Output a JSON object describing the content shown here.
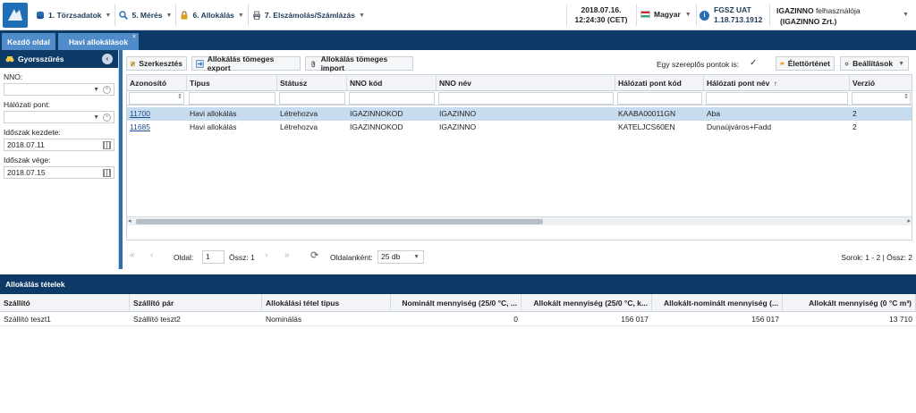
{
  "header": {
    "menu": [
      {
        "label": "1. Törzsadatok",
        "icon": "database-icon"
      },
      {
        "label": "5. Mérés",
        "icon": "magnifier-icon"
      },
      {
        "label": "6. Allokálás",
        "icon": "lock-icon"
      },
      {
        "label": "7. Elszámolás/Számlázás",
        "icon": "printer-icon"
      }
    ],
    "date": "2018.07.16.",
    "time": "12:24:30 (CET)",
    "language": "Magyar",
    "env_name": "FGSZ UAT",
    "version": "1.18.713.1912",
    "user_name": "IGAZINNO",
    "user_suffix": "felhasználója",
    "company": "(IGAZINNO Zrt.)"
  },
  "tabs": [
    {
      "label": "Kezdő oldal"
    },
    {
      "label": "Havi allokálások",
      "close": "×"
    }
  ],
  "quickfilter": {
    "title": "Gyorsszűrés",
    "fields": [
      {
        "label": "NNO:",
        "value": ""
      },
      {
        "label": "Hálózati pont:",
        "value": ""
      },
      {
        "label": "Időszak kezdete:",
        "value": "2018.07.11"
      },
      {
        "label": "Időszak vége:",
        "value": "2018.07.15"
      }
    ]
  },
  "toolbar": {
    "edit": "Szerkesztés",
    "export": "Allokálás tömeges export",
    "import": "Allokálás tömeges import",
    "single_player_label": "Egy szereplős pontok is:",
    "history": "Élettörténet",
    "settings": "Beállítások"
  },
  "grid": {
    "columns": [
      "Azonosító",
      "Típus",
      "Státusz",
      "NNO kód",
      "NNO név",
      "Hálózati pont kód",
      "Hálózati pont név",
      "Verzió"
    ],
    "rows": [
      {
        "id": "11700",
        "type": "Havi allokálás",
        "status": "Létrehozva",
        "nno_code": "IGAZINNOKOD",
        "nno_name": "IGAZINNO",
        "point_code": "KAABA00011GN",
        "point_name": "Aba",
        "version": "2"
      },
      {
        "id": "11685",
        "type": "Havi allokálás",
        "status": "Létrehozva",
        "nno_code": "IGAZINNOKOD",
        "nno_name": "IGAZINNO",
        "point_code": "KATELJCS60EN",
        "point_name": "Dunaújváros+Fadd",
        "version": "2"
      }
    ]
  },
  "pager": {
    "page_label": "Oldal:",
    "page": "1",
    "total": "Össz: 1",
    "per_page_label": "Oldalanként:",
    "per_page": "25 db",
    "summary": "Sorok: 1 - 2 | Össz: 2"
  },
  "items": {
    "title": "Allokálás tételek",
    "columns": [
      "Szállító",
      "Szállító pár",
      "Allokálási tétel típus",
      "Nominált mennyiség (25/0 °C, ...",
      "Allokált mennyiség (25/0 °C, k...",
      "Allokált-nominált mennyiség (...",
      "Allokált mennyiség (0 °C m³)"
    ],
    "rows": [
      {
        "supplier": "Szállító teszt1",
        "pair": "Szállító teszt2",
        "type": "Nominálás",
        "nominated": "0",
        "allocated": "156 017",
        "diff": "156 017",
        "allocated0": "13 710"
      }
    ]
  },
  "colors": {
    "navy": "#0d3a66",
    "tab_blue": "#4f8cc9",
    "selected_row": "#c7dcef"
  }
}
